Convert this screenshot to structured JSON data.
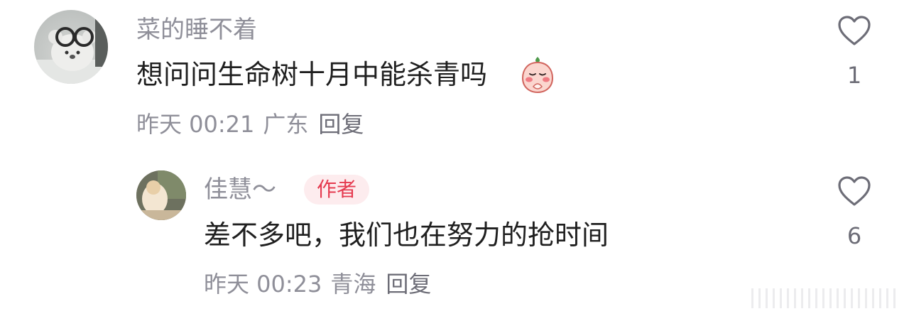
{
  "comments": [
    {
      "username": "菜的睡不着",
      "text": "想问问生命树十月中能杀青吗",
      "time": "昨天 00:21",
      "location": "广东",
      "reply_label": "回复",
      "like_count": "1",
      "avatar_icon": "avatar-plush-with-glasses",
      "sticker_icon": "peach-praying-emoji"
    },
    {
      "username": "佳慧～",
      "badge": "作者",
      "text": "差不多吧，我们也在努力的抢时间",
      "time": "昨天 00:23",
      "location": "青海",
      "reply_label": "回复",
      "like_count": "6",
      "avatar_icon": "avatar-photo"
    }
  ],
  "colors": {
    "meta_gray": "#8f8f99",
    "text_dark": "#1f1f1f",
    "author_badge_bg": "#fdecee",
    "author_badge_text": "#e53a4f"
  }
}
